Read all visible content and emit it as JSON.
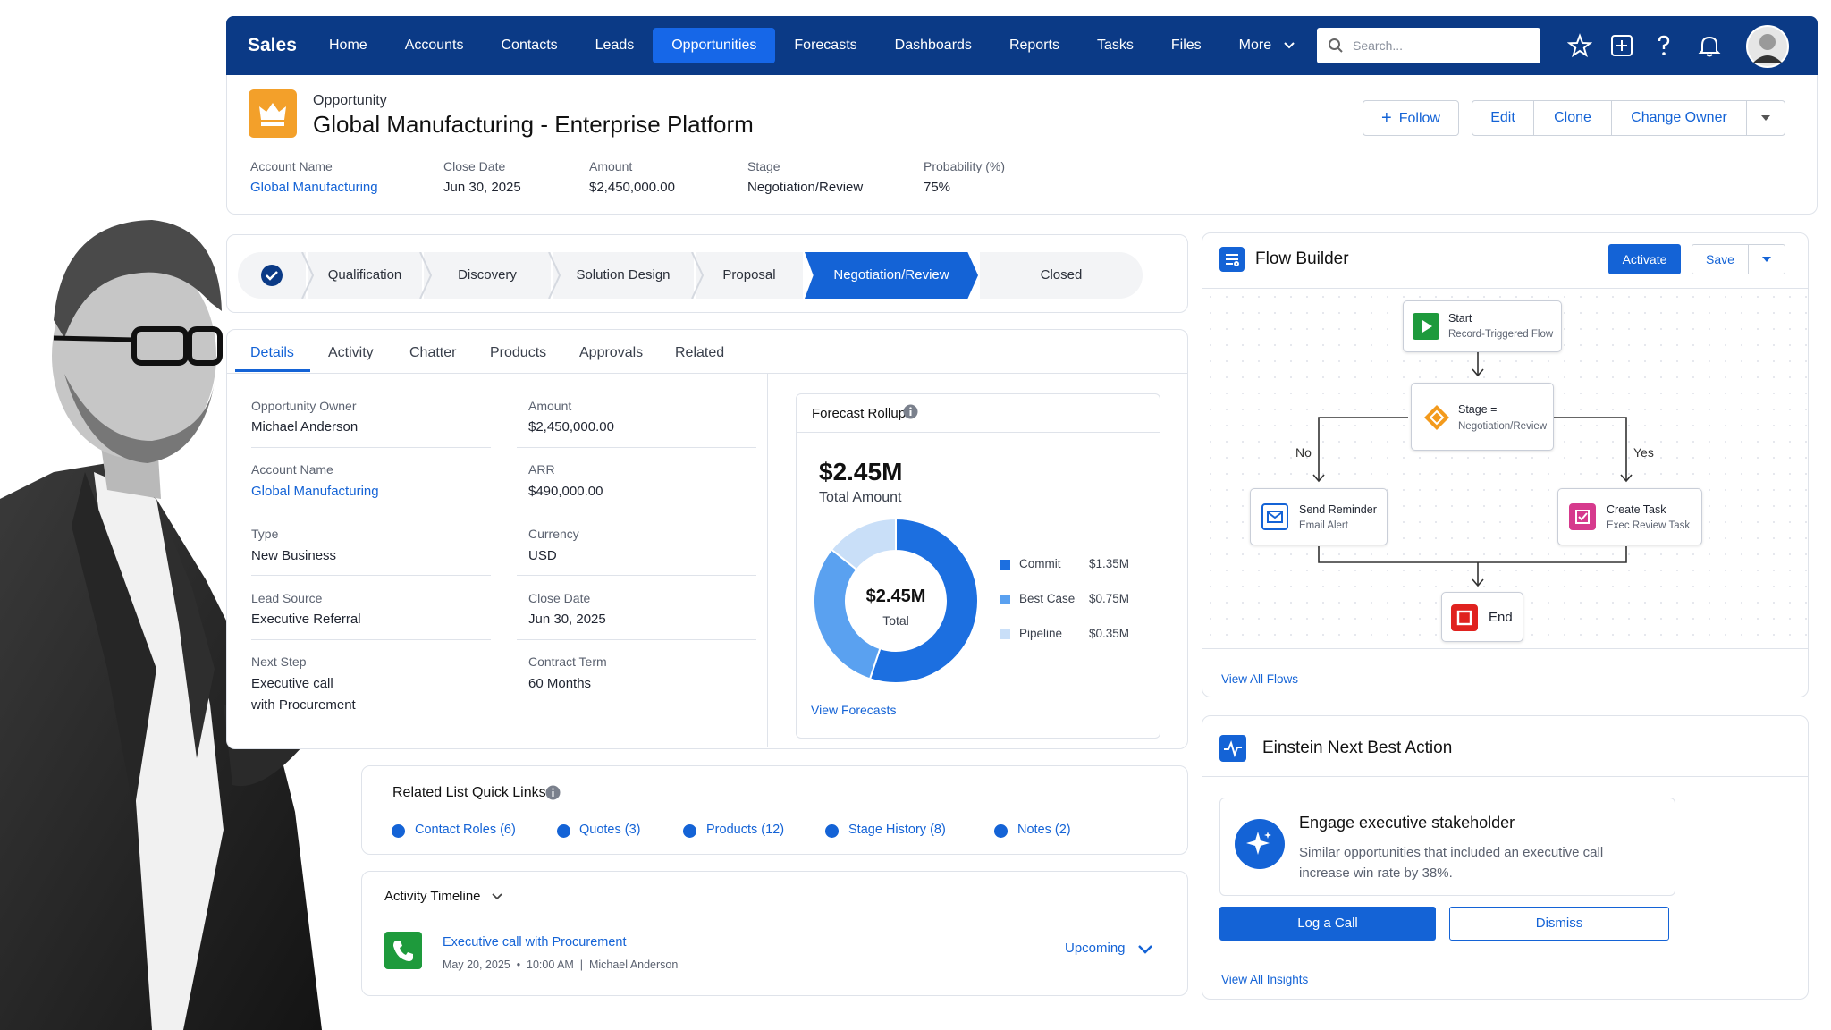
{
  "nav": {
    "brand": "Sales",
    "tabs": [
      "Home",
      "Accounts",
      "Contacts",
      "Leads",
      "Opportunities",
      "Forecasts",
      "Dashboards",
      "Reports",
      "Tasks",
      "Files",
      "More"
    ],
    "active_tab": "Opportunities",
    "search_placeholder": "Search...",
    "icons": [
      "star-icon",
      "plus-square-icon",
      "help-icon",
      "bell-icon",
      "avatar"
    ]
  },
  "record": {
    "object_label": "Opportunity",
    "title": "Global Manufacturing - Enterprise Platform",
    "actions": {
      "follow": "Follow",
      "edit": "Edit",
      "clone": "Clone",
      "change_owner": "Change Owner"
    },
    "highlights": [
      {
        "label": "Account Name",
        "value": "Global Manufacturing"
      },
      {
        "label": "Close Date",
        "value": "Jun 30, 2025"
      },
      {
        "label": "Amount",
        "value": "$2,450,000.00"
      },
      {
        "label": "Stage",
        "value": "Negotiation/Review"
      },
      {
        "label": "Probability (%)",
        "value": "75%"
      }
    ]
  },
  "path": {
    "stages": [
      "Qualification",
      "Discovery",
      "Solution Design",
      "Proposal",
      "Negotiation/Review",
      "Closed"
    ],
    "current": "Negotiation/Review"
  },
  "detail_tabs": [
    "Details",
    "Activity",
    "Chatter",
    "Products",
    "Approvals",
    "Related"
  ],
  "details": {
    "left": [
      {
        "label": "Opportunity Owner",
        "value": "Michael Anderson"
      },
      {
        "label": "Account Name",
        "value": "Global Manufacturing"
      },
      {
        "label": "Type",
        "value": "New Business"
      },
      {
        "label": "Lead Source",
        "value": "Executive Referral"
      },
      {
        "label": "Next Step",
        "value": "Executive call",
        "value2": "with Procurement"
      }
    ],
    "right": [
      {
        "label": "Amount",
        "value": "$2,450,000.00"
      },
      {
        "label": "ARR",
        "value": "$490,000.00"
      },
      {
        "label": "Currency",
        "value": "USD"
      },
      {
        "label": "Close Date",
        "value": "Jun 30, 2025"
      },
      {
        "label": "Contract Term",
        "value": "60 Months"
      }
    ]
  },
  "forecast": {
    "title": "Forecast Rollup",
    "big_value": "$2.45M",
    "big_label": "Total Amount",
    "center_value": "$2.45M",
    "center_label": "Total",
    "view_link": "View Forecasts",
    "colors": {
      "commit": "#1c6fe0",
      "best_case": "#5aa1f0",
      "pipeline": "#c9dff8"
    }
  },
  "chart_data": {
    "type": "pie",
    "categories": [
      "Commit",
      "Best Case",
      "Pipeline"
    ],
    "values": [
      1.35,
      0.75,
      0.35
    ],
    "value_labels": [
      "$1.35M",
      "$0.75M",
      "$0.35M"
    ]
  },
  "quicklinks": {
    "title": "Related List Quick Links",
    "items": [
      "Contact Roles (6)",
      "Quotes (3)",
      "Products (12)",
      "Stage History (8)",
      "Notes (2)"
    ]
  },
  "timeline": {
    "title": "Activity Timeline",
    "item_title": "Executive call with Procurement",
    "item_meta": "May 20, 2025  •  10:00 AM  |  Michael Anderson",
    "status": "Upcoming"
  },
  "flow": {
    "title": "Flow Builder",
    "activate": "Activate",
    "save": "Save",
    "start_title": "Start",
    "start_sub": "Record-Triggered Flow",
    "decision_title": "Stage =",
    "decision_sub": "Negotiation/Review",
    "no_label": "No",
    "yes_label": "Yes",
    "left_title": "Send Reminder",
    "left_sub": "Email Alert",
    "right_title": "Create Task",
    "right_sub": "Exec Review Task",
    "end_label": "End",
    "view_link": "View All Flows"
  },
  "einstein": {
    "title": "Einstein Next Best Action",
    "rec_title": "Engage executive stakeholder",
    "rec_line1": "Similar opportunities that included an executive call",
    "rec_line2": "increase win rate by 38%.",
    "primary": "Log a Call",
    "secondary": "Dismiss",
    "view_link": "View All Insights"
  }
}
